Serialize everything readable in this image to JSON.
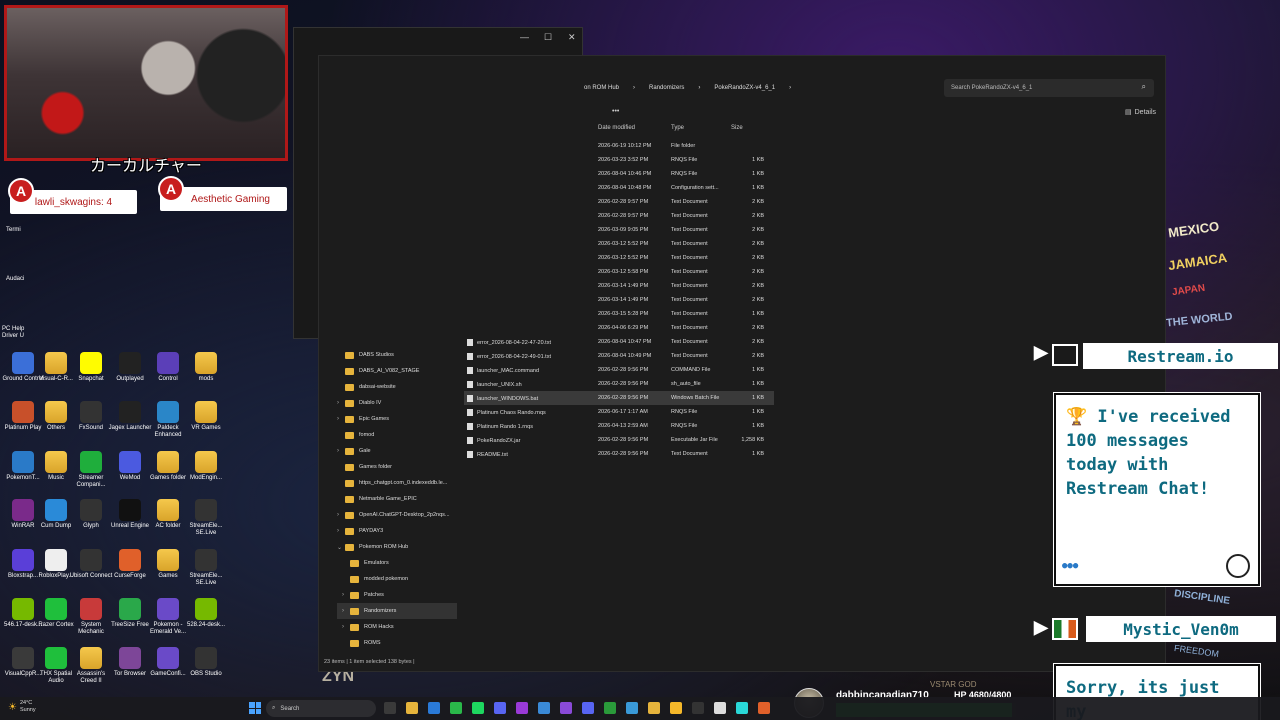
{
  "webcam": {
    "caption": "カーカルチャー",
    "viewer_left": "lawli_skwagins: 4",
    "viewer_right": "Aesthetic Gaming",
    "logo_glyph": "A"
  },
  "desktop": {
    "left_edge_labels": [
      "Termi",
      "Audaci",
      "PC Help Driver U"
    ],
    "icons": [
      {
        "label": "Ground Control",
        "icon": "ground-control-icon",
        "color": "#3b6fd8"
      },
      {
        "label": "Visual-C-R...",
        "icon": "folder-icon",
        "color": "folder"
      },
      {
        "label": "Snapchat",
        "icon": "snapchat-icon",
        "color": "#fffc00"
      },
      {
        "label": "Outplayed",
        "icon": "outplayed-icon",
        "color": "#222222"
      },
      {
        "label": "Control",
        "icon": "control-icon",
        "color": "#5b3fb8"
      },
      {
        "label": "mods",
        "icon": "folder-icon",
        "color": "folder"
      },
      {
        "label": "Platinum Play",
        "icon": "platinum-play-icon",
        "color": "#c8502a"
      },
      {
        "label": "Others",
        "icon": "folder-icon",
        "color": "folder"
      },
      {
        "label": "FxSound",
        "icon": "fxsound-icon",
        "color": "#333333"
      },
      {
        "label": "Jagex Launcher",
        "icon": "jagex-icon",
        "color": "#222222"
      },
      {
        "label": "Paldeck Enhanced",
        "icon": "paldeck-icon",
        "color": "#2a86c8"
      },
      {
        "label": "VR Games",
        "icon": "folder-icon",
        "color": "folder"
      },
      {
        "label": "PokemonT...",
        "icon": "pokemon-icon",
        "color": "#2a7ac8"
      },
      {
        "label": "Music",
        "icon": "folder-icon",
        "color": "folder"
      },
      {
        "label": "Streamer Compani...",
        "icon": "streamer-companion-icon",
        "color": "#1fae3c"
      },
      {
        "label": "WeMod",
        "icon": "wemod-icon",
        "color": "#4b5ae0"
      },
      {
        "label": "Games folder",
        "icon": "folder-icon",
        "color": "folder"
      },
      {
        "label": "ModEngin...",
        "icon": "folder-icon",
        "color": "folder"
      },
      {
        "label": "WinRAR",
        "icon": "winrar-icon",
        "color": "#7a2a8a"
      },
      {
        "label": "Cum Dump",
        "icon": "folder-icon",
        "color": "#2a8ad8"
      },
      {
        "label": "Glyph",
        "icon": "glyph-icon",
        "color": "#333333"
      },
      {
        "label": "Unreal Engine",
        "icon": "unreal-icon",
        "color": "#111111"
      },
      {
        "label": "AC folder",
        "icon": "folder-icon",
        "color": "folder"
      },
      {
        "label": "StreamEle... SE.Live",
        "icon": "streamelements-icon",
        "color": "#333333"
      },
      {
        "label": "Bloxstrap...",
        "icon": "bloxstrap-icon",
        "color": "#5a3fd8"
      },
      {
        "label": "RobloxPlay...",
        "icon": "roblox-icon",
        "color": "#eeeeee"
      },
      {
        "label": "Ubisoft Connect",
        "icon": "ubisoft-icon",
        "color": "#333333"
      },
      {
        "label": "CurseForge",
        "icon": "curseforge-icon",
        "color": "#e0602a"
      },
      {
        "label": "Games",
        "icon": "folder-icon",
        "color": "folder"
      },
      {
        "label": "StreamEle... SE.Live",
        "icon": "streamelements-icon",
        "color": "#333333"
      },
      {
        "label": "546.17-desk...",
        "icon": "nvidia-icon",
        "color": "#76b900"
      },
      {
        "label": "Razer Cortex",
        "icon": "razer-icon",
        "color": "#1fbf3c"
      },
      {
        "label": "System Mechanic",
        "icon": "system-mechanic-icon",
        "color": "#c83a3a"
      },
      {
        "label": "TreeSize Free",
        "icon": "treesize-icon",
        "color": "#2aa84a"
      },
      {
        "label": "Pokemon - Emerald Ve...",
        "icon": "emulator-icon",
        "color": "#6a4ac8"
      },
      {
        "label": "528.24-desk...",
        "icon": "nvidia-icon",
        "color": "#76b900"
      },
      {
        "label": "VisualCppR...",
        "icon": "visualcpp-icon",
        "color": "#3a3a3a"
      },
      {
        "label": "THX Spatial Audio",
        "icon": "thx-icon",
        "color": "#1fbf3c"
      },
      {
        "label": "Assassin's Creed II",
        "icon": "folder-icon",
        "color": "folder"
      },
      {
        "label": "Tor Browser",
        "icon": "tor-icon",
        "color": "#7d4698"
      },
      {
        "label": "GameConfi...",
        "icon": "emulator-icon",
        "color": "#6a4ac8"
      },
      {
        "label": "OBS Studio",
        "icon": "obs-icon",
        "color": "#333333"
      }
    ]
  },
  "dark_window": {
    "minimize": "—",
    "maximize": "☐",
    "close": "✕"
  },
  "explorer": {
    "breadcrumb": [
      "on ROM Hub",
      "Randomizers",
      "PokeRandoZX-v4_6_1"
    ],
    "search_placeholder": "Search PokeRandoZX-v4_6_1",
    "details_label": "Details",
    "more_label": "•••",
    "columns": {
      "date": "Date modified",
      "type": "Type",
      "size": "Size"
    },
    "files": [
      {
        "name": "",
        "date": "2026-06-19 10:12 PM",
        "type": "File folder",
        "size": ""
      },
      {
        "name": "",
        "date": "2026-03-23 3:52 PM",
        "type": "RNQS File",
        "size": "1 KB"
      },
      {
        "name": "",
        "date": "2026-08-04 10:46 PM",
        "type": "RNQS File",
        "size": "1 KB"
      },
      {
        "name": "",
        "date": "2026-08-04 10:48 PM",
        "type": "Configuration sett...",
        "size": "1 KB"
      },
      {
        "name": "",
        "date": "2026-02-28 9:57 PM",
        "type": "Text Document",
        "size": "2 KB"
      },
      {
        "name": "",
        "date": "2026-02-28 9:57 PM",
        "type": "Text Document",
        "size": "2 KB"
      },
      {
        "name": "",
        "date": "2026-03-09 9:05 PM",
        "type": "Text Document",
        "size": "2 KB"
      },
      {
        "name": "",
        "date": "2026-03-12 5:52 PM",
        "type": "Text Document",
        "size": "2 KB"
      },
      {
        "name": "",
        "date": "2026-03-12 5:52 PM",
        "type": "Text Document",
        "size": "2 KB"
      },
      {
        "name": "",
        "date": "2026-03-12 5:58 PM",
        "type": "Text Document",
        "size": "2 KB"
      },
      {
        "name": "",
        "date": "2026-03-14 1:49 PM",
        "type": "Text Document",
        "size": "2 KB"
      },
      {
        "name": "",
        "date": "2026-03-14 1:49 PM",
        "type": "Text Document",
        "size": "2 KB"
      },
      {
        "name": "",
        "date": "2026-03-15 5:28 PM",
        "type": "Text Document",
        "size": "1 KB"
      },
      {
        "name": "",
        "date": "2026-04-06 6:29 PM",
        "type": "Text Document",
        "size": "2 KB"
      },
      {
        "name": "error_2026-08-04-22-47-20.txt",
        "date": "2026-08-04 10:47 PM",
        "type": "Text Document",
        "size": "2 KB"
      },
      {
        "name": "error_2026-08-04-22-49-01.txt",
        "date": "2026-08-04 10:49 PM",
        "type": "Text Document",
        "size": "2 KB"
      },
      {
        "name": "launcher_MAC.command",
        "date": "2026-02-28 9:56 PM",
        "type": "COMMAND File",
        "size": "1 KB"
      },
      {
        "name": "launcher_UNIX.sh",
        "date": "2026-02-28 9:56 PM",
        "type": "sh_auto_file",
        "size": "1 KB"
      },
      {
        "name": "launcher_WINDOWS.bat",
        "date": "2026-02-28 9:56 PM",
        "type": "Windows Batch File",
        "size": "1 KB"
      },
      {
        "name": "Platinum Chaos Rando.rnqs",
        "date": "2026-06-17 1:17 AM",
        "type": "RNQS File",
        "size": "1 KB"
      },
      {
        "name": "Platinum Rando 1.rnqs",
        "date": "2026-04-13 2:59 AM",
        "type": "RNQS File",
        "size": "1 KB"
      },
      {
        "name": "PokeRandoZX.jar",
        "date": "2026-02-28 9:56 PM",
        "type": "Executable Jar File",
        "size": "1,258 KB"
      },
      {
        "name": "README.txt",
        "date": "2026-02-28 9:56 PM",
        "type": "Text Document",
        "size": "1 KB"
      }
    ],
    "selected_index": 18,
    "tree": [
      {
        "label": "DABS Studios",
        "expander": "",
        "indent": 0
      },
      {
        "label": "DABS_AI_V082_STAGE",
        "expander": "",
        "indent": 0
      },
      {
        "label": "dabsai-website",
        "expander": "",
        "indent": 0
      },
      {
        "label": "Diablo IV",
        "expander": "›",
        "indent": 0
      },
      {
        "label": "Epic Games",
        "expander": "›",
        "indent": 0
      },
      {
        "label": "fomod",
        "expander": "",
        "indent": 0
      },
      {
        "label": "Gale",
        "expander": "›",
        "indent": 0
      },
      {
        "label": "Games folder",
        "expander": "",
        "indent": 0
      },
      {
        "label": "https_chatgpt.com_0.indexeddb.le...",
        "expander": "",
        "indent": 0
      },
      {
        "label": "Netmarble Game_EPIC",
        "expander": "",
        "indent": 0
      },
      {
        "label": "OpenAI.ChatGPT-Desktop_2p2nqs...",
        "expander": "›",
        "indent": 0
      },
      {
        "label": "PAYDAY3",
        "expander": "›",
        "indent": 0
      },
      {
        "label": "Pokemon ROM Hub",
        "expander": "⌄",
        "indent": 0
      },
      {
        "label": "Emulators",
        "expander": "",
        "indent": 1
      },
      {
        "label": "modded pokemon",
        "expander": "",
        "indent": 1
      },
      {
        "label": "Patches",
        "expander": "›",
        "indent": 1
      },
      {
        "label": "Randomizers",
        "expander": "›",
        "indent": 1
      },
      {
        "label": "ROM Hacks",
        "expander": "›",
        "indent": 1
      },
      {
        "label": "ROMS",
        "expander": "",
        "indent": 1
      }
    ],
    "tree_active_index": 16,
    "status": "23 items  |  1 item selected  138 bytes  |"
  },
  "wallpaper_text": [
    "MEXICO",
    "JAMAICA",
    "JAPAN",
    "THE WORLD",
    "DISCIPLINE",
    "FREEDOM",
    "VSTAR GOD",
    "ZYN"
  ],
  "chat": {
    "first_user": "Restream.io",
    "first_message": "🏆 I've received 100 messages today with Restream Chat!",
    "dots": "●●●",
    "second_user": "Mystic_Ven0m",
    "second_message": "Sorry, its just my"
  },
  "stream_stats": {
    "username": "dabbincanadian710",
    "hp": "HP 4680/4800"
  },
  "taskbar": {
    "weather_temp": "24°C",
    "weather_desc": "Sunny",
    "search_label": "Search"
  }
}
